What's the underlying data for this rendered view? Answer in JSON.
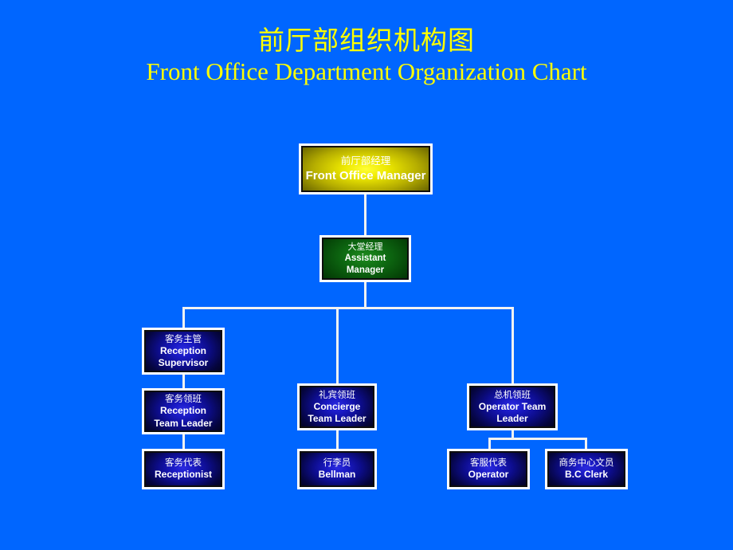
{
  "slide": {
    "background_color": "#0066FF",
    "title_color": "#FFFF00",
    "connector_color": "#F2F2F2",
    "title_cn": "前厅部组织机构图",
    "title_en": "Front Office Department Organization Chart"
  },
  "chart_data": {
    "type": "diagram",
    "title": "前厅部组织机构图 / Front Office Department Organization Chart",
    "nodes": [
      {
        "id": "fom",
        "cn": "前厅部经理",
        "en": "Front Office Manager",
        "level": 1,
        "color": "#EDE800"
      },
      {
        "id": "am",
        "cn": "大堂经理",
        "en": "Assistant Manager",
        "level": 2,
        "color": "#0E6B12"
      },
      {
        "id": "rsup",
        "cn": "客务主管",
        "en": "Reception Supervisor",
        "level": 3,
        "color": "#1A1AC4"
      },
      {
        "id": "rtl",
        "cn": "客务领班",
        "en": "Reception Team Leader",
        "level": 4,
        "color": "#1A1AC4"
      },
      {
        "id": "rcp",
        "cn": "客务代表",
        "en": "Receptionist",
        "level": 5,
        "color": "#1A1AC4"
      },
      {
        "id": "ctl",
        "cn": "礼宾领班",
        "en": "Concierge Team Leader",
        "level": 3,
        "color": "#1A1AC4"
      },
      {
        "id": "blm",
        "cn": "行李员",
        "en": "Bellman",
        "level": 4,
        "color": "#1A1AC4"
      },
      {
        "id": "otl",
        "cn": "总机领班",
        "en": "Operator Team Leader",
        "level": 3,
        "color": "#1A1AC4"
      },
      {
        "id": "opr",
        "cn": "客服代表",
        "en": "Operator",
        "level": 4,
        "color": "#1A1AC4"
      },
      {
        "id": "bcc",
        "cn": "商务中心文员",
        "en": "B.C Clerk",
        "level": 4,
        "color": "#1A1AC4"
      }
    ],
    "edges": [
      {
        "from": "fom",
        "to": "am"
      },
      {
        "from": "am",
        "to": "rsup"
      },
      {
        "from": "am",
        "to": "ctl"
      },
      {
        "from": "am",
        "to": "otl"
      },
      {
        "from": "rsup",
        "to": "rtl"
      },
      {
        "from": "rtl",
        "to": "rcp"
      },
      {
        "from": "ctl",
        "to": "blm"
      },
      {
        "from": "otl",
        "to": "opr"
      },
      {
        "from": "otl",
        "to": "bcc"
      }
    ]
  }
}
